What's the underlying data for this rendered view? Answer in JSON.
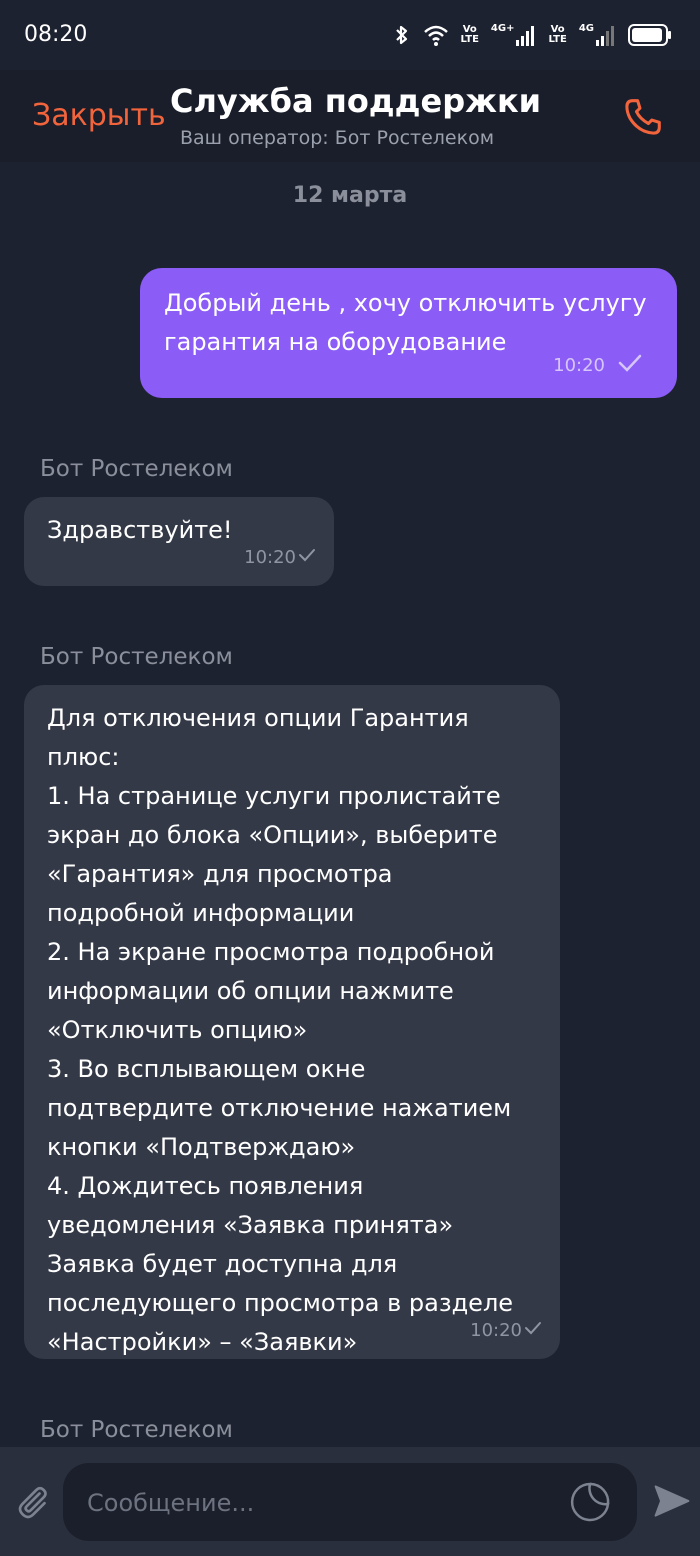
{
  "status_bar": {
    "time": "08:20",
    "icons": [
      "bluetooth-icon",
      "wifi-icon",
      "volte-icon",
      "signal-4g-plus-icon",
      "volte-icon",
      "signal-4g-icon",
      "battery-icon"
    ],
    "vo": "Vo",
    "lte": "LTE",
    "net1": "4G+",
    "net2": "4G"
  },
  "header": {
    "close_label": "Закрыть",
    "title": "Служба поддержки",
    "subtitle": "Ваш оператор: Бот Ростелеком",
    "call_icon": "phone-icon"
  },
  "chat": {
    "date_separator": "12 марта",
    "messages": [
      {
        "direction": "outgoing",
        "text": "Добрый день , хочу отключить услугу гарантия на оборудование",
        "time": "10:20"
      },
      {
        "direction": "incoming",
        "sender": "Бот Ростелеком",
        "text": "Здравствуйте!",
        "time": "10:20"
      },
      {
        "direction": "incoming",
        "sender": "Бот Ростелеком",
        "text": "Для отключения опции Гарантия плюс:\n1. На странице услуги пролистайте экран до блока «Опции», выберите «Гарантия» для просмотра подробной информации\n2. На экране просмотра подробной информации об опции нажмите «Отключить опцию»\n3. Во всплывающем окне подтвердите отключение нажатием кнопки «Подтверждаю»\n4. Дождитесь появления уведомления «Заявка принята»\nЗаявка будет доступна для последующего просмотра в разделе «Настройки» – «Заявки»",
        "time": "10:20"
      },
      {
        "direction": "incoming",
        "sender": "Бот Ростелеком"
      }
    ]
  },
  "composer": {
    "placeholder": "Сообщение...",
    "attach_icon": "paperclip-icon",
    "sticker_icon": "sticker-icon",
    "send_icon": "send-icon"
  },
  "colors": {
    "background": "#1d2230",
    "accent": "#f2643c",
    "outgoing_bubble": "#8b5cf6",
    "incoming_bubble": "#343947"
  }
}
